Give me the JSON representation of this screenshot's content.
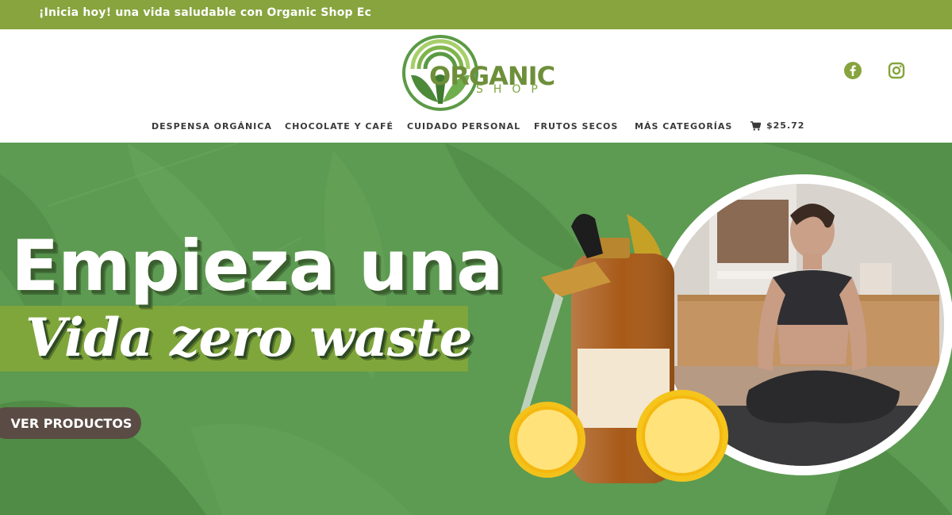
{
  "topbar": {
    "promo_text": "¡Inicia hoy! una vida saludable con Organic Shop Ec",
    "background": "#87a43e"
  },
  "header": {
    "logo": {
      "brand": "ORGANIC",
      "sub": "SHOP"
    },
    "social": [
      {
        "icon": "facebook-icon",
        "color": "#87a43e"
      },
      {
        "icon": "instagram-icon",
        "color": "#87a43e"
      }
    ]
  },
  "nav": {
    "items": [
      {
        "label": "DESPENSA ORGÁNICA"
      },
      {
        "label": "CHOCOLATE Y CAFÉ"
      },
      {
        "label": "CUIDADO PERSONAL"
      },
      {
        "label": "FRUTOS SECOS"
      },
      {
        "label": "MÁS CATEGORÍAS"
      }
    ],
    "cart": {
      "icon": "cart-icon",
      "amount": "$25.72"
    }
  },
  "hero": {
    "headline": "Empieza una",
    "script_line": "Vida zero waste",
    "cta_label": "VER PRODUCTOS",
    "colors": {
      "background": "#5d9a52",
      "band": "#7fa63b",
      "cta": "#5a4b44"
    }
  }
}
